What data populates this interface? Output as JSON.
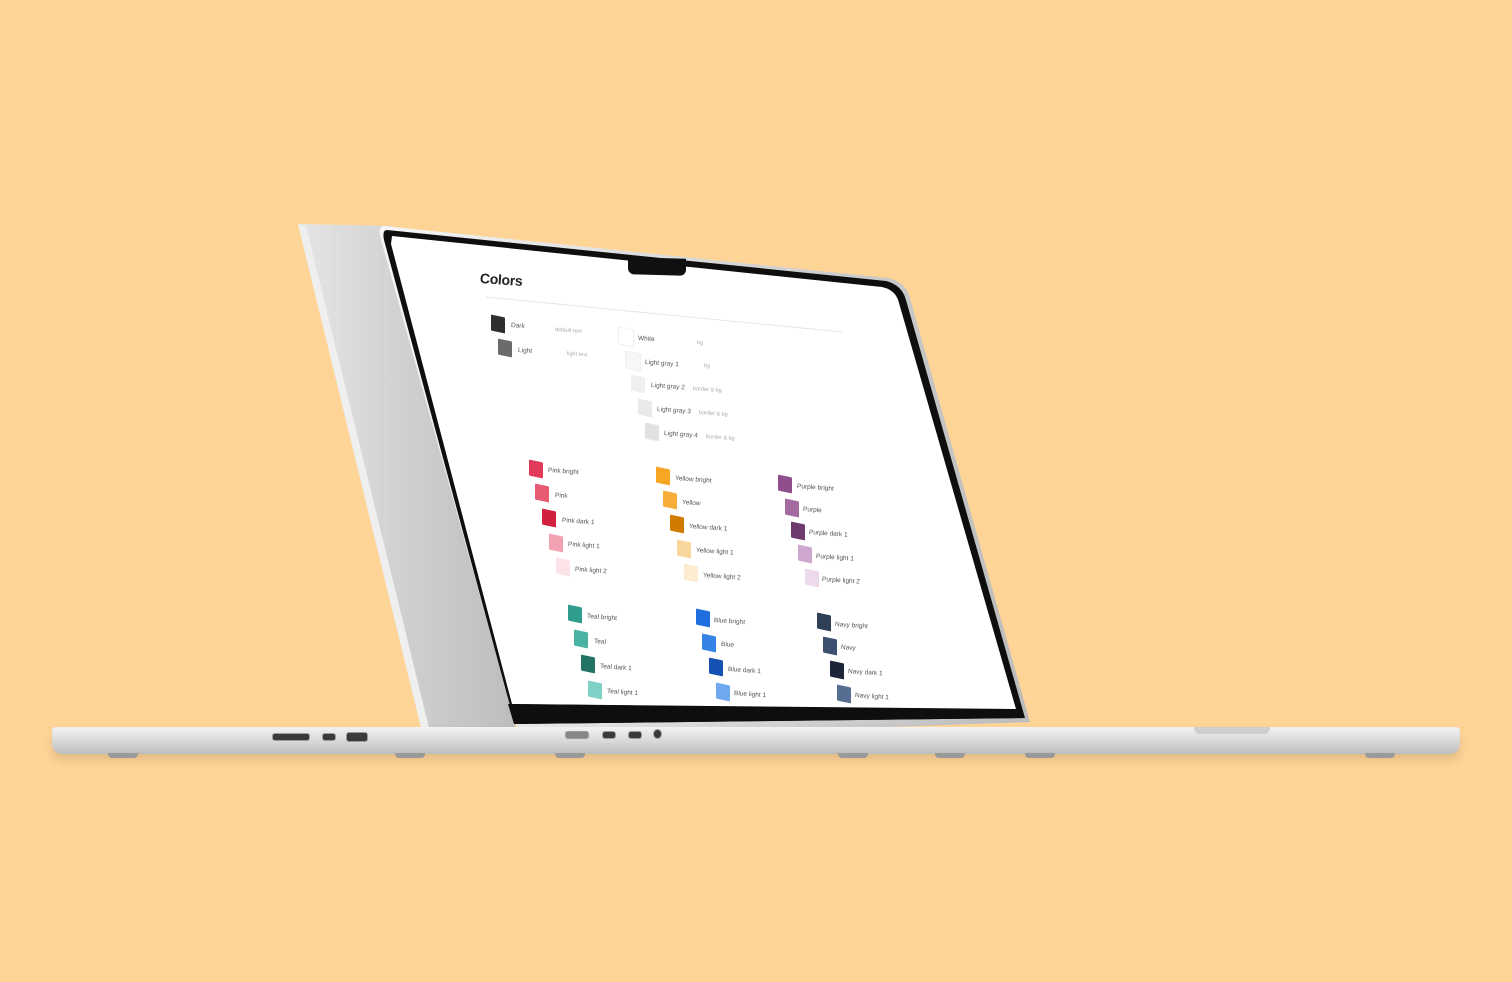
{
  "page": {
    "title": "Colors"
  },
  "neutrals_left": [
    {
      "name": "Dark",
      "desc": "default text",
      "color": "#2f2f2f"
    },
    {
      "name": "Light",
      "desc": "light text",
      "color": "#6b6b6b"
    }
  ],
  "neutrals_right": [
    {
      "name": "White",
      "desc": "bg",
      "color": "#ffffff"
    },
    {
      "name": "Light gray 1",
      "desc": "bg",
      "color": "#f7f7f7"
    },
    {
      "name": "Light gray 2",
      "desc": "border & bg",
      "color": "#f0f0f0"
    },
    {
      "name": "Light gray 3",
      "desc": "border & bg",
      "color": "#e9e9e9"
    },
    {
      "name": "Light gray 4",
      "desc": "border & bg",
      "color": "#e2e2e2"
    }
  ],
  "groups": [
    {
      "items": [
        {
          "name": "Pink bright",
          "color": "#e23a5a"
        },
        {
          "name": "Pink",
          "color": "#e65a72"
        },
        {
          "name": "Pink dark 1",
          "color": "#d1213f"
        },
        {
          "name": "Pink light 1",
          "color": "#f1a3b1"
        },
        {
          "name": "Pink light 2",
          "color": "#fbe3e8"
        }
      ]
    },
    {
      "items": [
        {
          "name": "Yellow bright",
          "color": "#f5a623"
        },
        {
          "name": "Yellow",
          "color": "#f6ad3a"
        },
        {
          "name": "Yellow dark 1",
          "color": "#d17a00"
        },
        {
          "name": "Yellow light 1",
          "color": "#f9d69b"
        },
        {
          "name": "Yellow light 2",
          "color": "#fdecd2"
        }
      ]
    },
    {
      "items": [
        {
          "name": "Purple bright",
          "color": "#8e4f8c"
        },
        {
          "name": "Purple",
          "color": "#a36ba1"
        },
        {
          "name": "Purple dark 1",
          "color": "#6f3a6e"
        },
        {
          "name": "Purple light 1",
          "color": "#cfa6cd"
        },
        {
          "name": "Purple light 2",
          "color": "#ecd9eb"
        }
      ]
    },
    {
      "items": [
        {
          "name": "Teal bright",
          "color": "#2f9e8c"
        },
        {
          "name": "Teal",
          "color": "#48b3a2"
        },
        {
          "name": "Teal dark 1",
          "color": "#237466"
        },
        {
          "name": "Teal light 1",
          "color": "#7ed1c5"
        }
      ]
    },
    {
      "items": [
        {
          "name": "Blue bright",
          "color": "#1f6fe0"
        },
        {
          "name": "Blue",
          "color": "#3683e6"
        },
        {
          "name": "Blue dark 1",
          "color": "#1552b3"
        },
        {
          "name": "Blue light 1",
          "color": "#6fa8ef"
        }
      ]
    },
    {
      "items": [
        {
          "name": "Navy bright",
          "color": "#2e3f57"
        },
        {
          "name": "Navy",
          "color": "#3e5070"
        },
        {
          "name": "Navy dark 1",
          "color": "#1b2638"
        },
        {
          "name": "Navy light 1",
          "color": "#566e92"
        }
      ]
    }
  ],
  "colors": {
    "background": "#FFD597",
    "laptop": "#d8d8d8",
    "bezel": "#0e0e0e",
    "screen": "#ffffff"
  }
}
